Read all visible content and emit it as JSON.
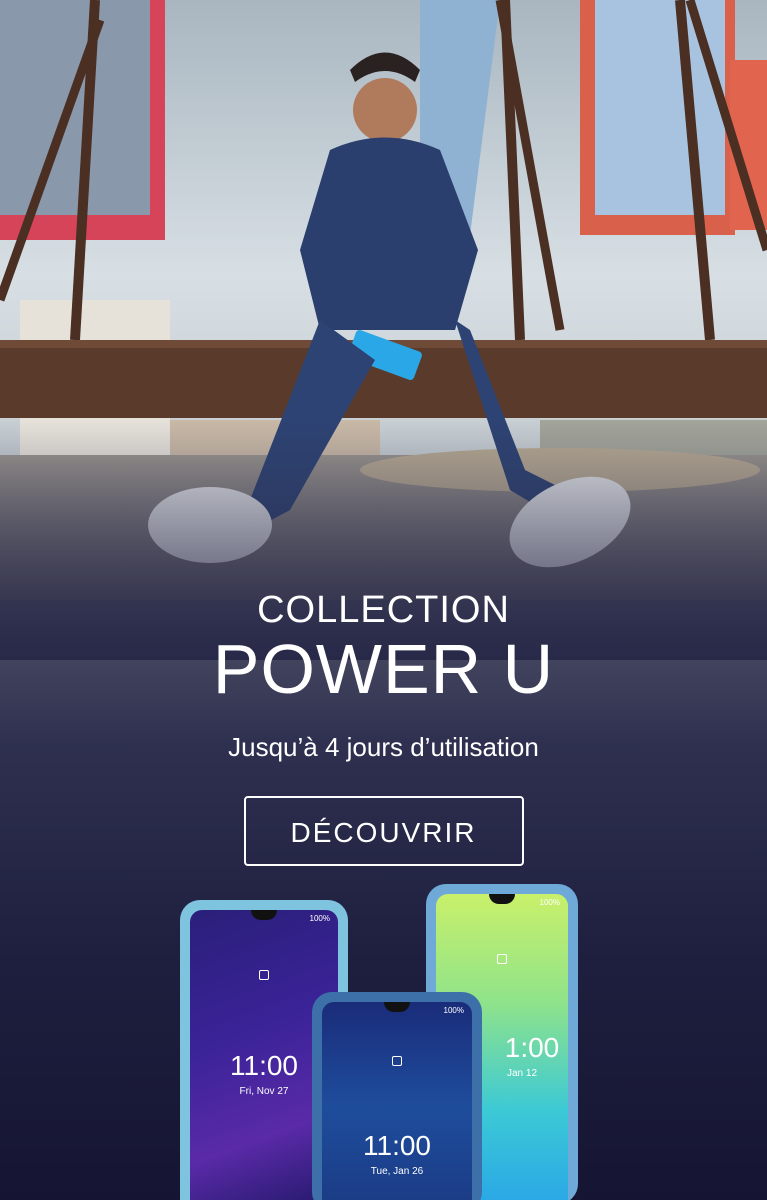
{
  "hero": {
    "eyebrow": "COLLECTION",
    "headline": "POWER U",
    "subline": "Jusqu’à 4 jours d’utilisation",
    "cta_label": "DÉCOUVRIR"
  },
  "phones": {
    "left": {
      "time": "11:00",
      "date": "Fri, Nov 27",
      "battery": "100%"
    },
    "middle": {
      "time": "11:00",
      "date": "Tue, Jan 26",
      "battery": "100%"
    },
    "right": {
      "time": "1:00",
      "date": "Jan 12",
      "battery": "100%"
    }
  },
  "colors": {
    "background_bottom": "#151533",
    "text": "#ffffff",
    "phone_cyan": "#7fc4de"
  }
}
